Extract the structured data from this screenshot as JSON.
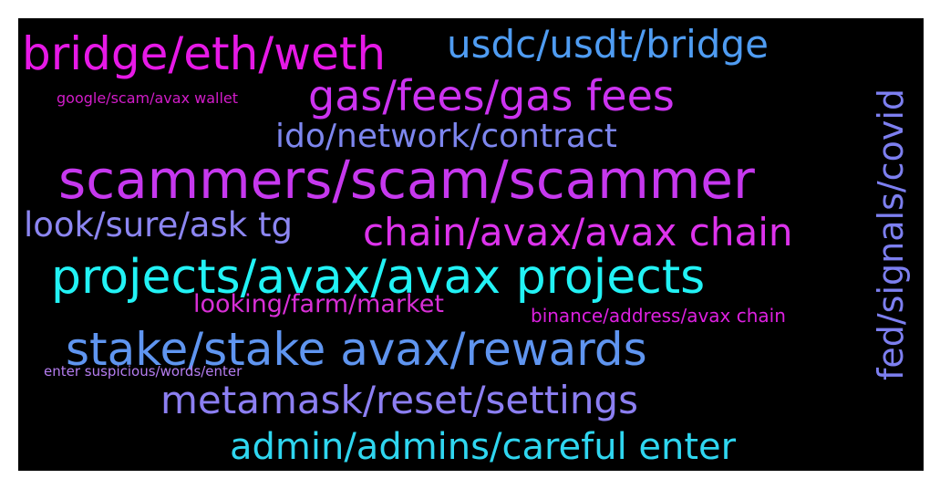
{
  "words": [
    {
      "text": "bridge/eth/weth",
      "color": "#e619e6"
    },
    {
      "text": "usdc/usdt/bridge",
      "color": "#4f9cf2"
    },
    {
      "text": "fed/signals/covid",
      "color": "#7d7ff0"
    },
    {
      "text": "google/scam/avax wallet",
      "color": "#d21cc9"
    },
    {
      "text": "gas/fees/gas fees",
      "color": "#cc33f0"
    },
    {
      "text": "ido/network/contract",
      "color": "#7d86ee"
    },
    {
      "text": "scammers/scam/scammer",
      "color": "#c638ee"
    },
    {
      "text": "look/sure/ask tg",
      "color": "#8c86f2"
    },
    {
      "text": "chain/avax/avax chain",
      "color": "#dd33ec"
    },
    {
      "text": "projects/avax/avax projects",
      "color": "#22f2f5"
    },
    {
      "text": "looking/farm/market",
      "color": "#d82fd6"
    },
    {
      "text": "binance/address/avax chain",
      "color": "#dd20e0"
    },
    {
      "text": "stake/stake avax/rewards",
      "color": "#5f95f0"
    },
    {
      "text": "enter suspicious/words/enter",
      "color": "#b57df0"
    },
    {
      "text": "metamask/reset/settings",
      "color": "#8c7ff2"
    },
    {
      "text": "admin/admins/careful enter",
      "color": "#2fd6f0"
    }
  ]
}
